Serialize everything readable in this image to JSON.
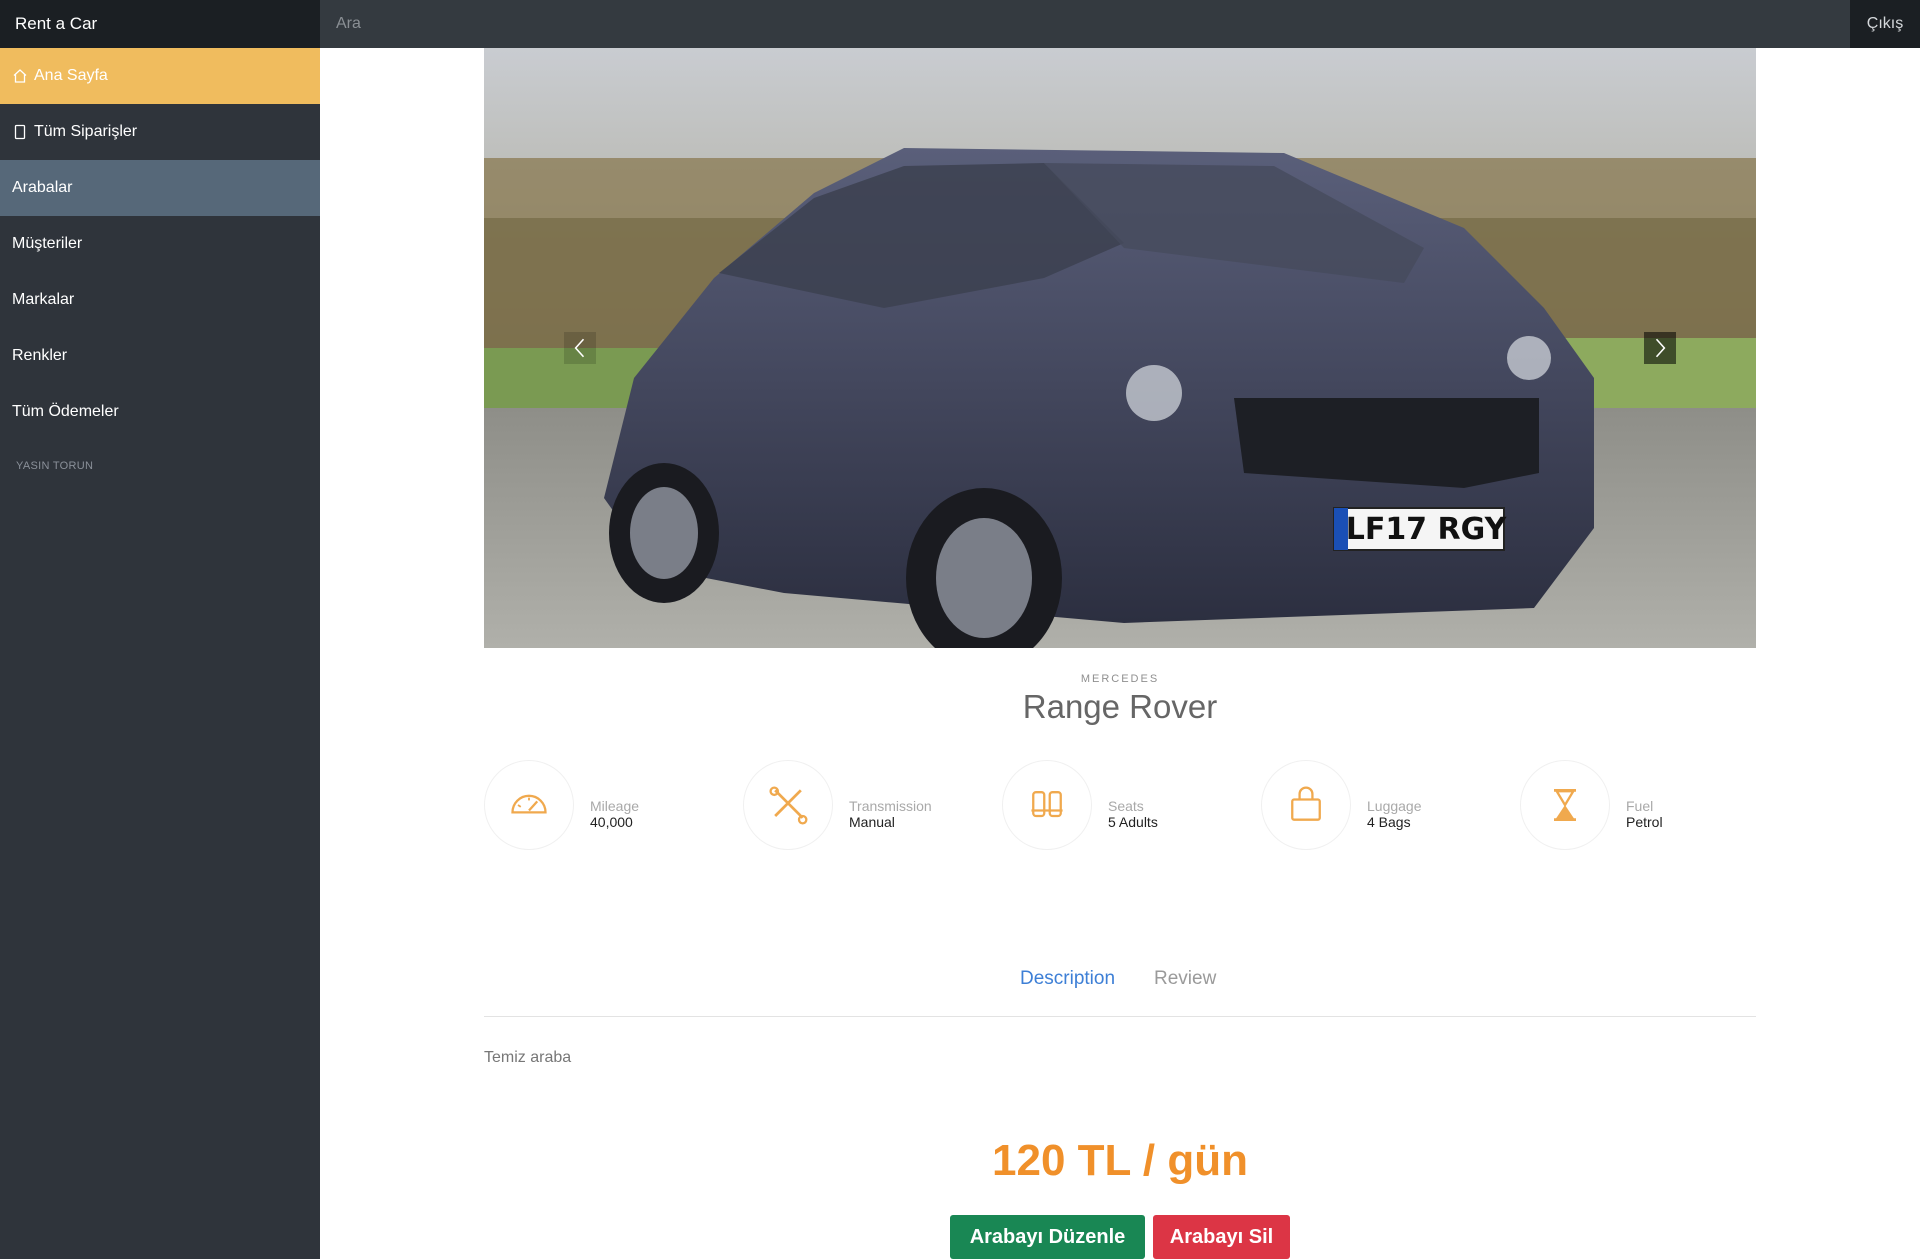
{
  "header": {
    "brand": "Rent a Car",
    "search_placeholder": "Ara",
    "logout_label": "Çıkış"
  },
  "sidebar": {
    "items": [
      {
        "label": "Ana Sayfa",
        "icon": "home-icon",
        "state": "active"
      },
      {
        "label": "Tüm Siparişler",
        "icon": "phone-icon",
        "state": "normal"
      },
      {
        "label": "Arabalar",
        "icon": "",
        "state": "selected"
      },
      {
        "label": "Müşteriler",
        "icon": "",
        "state": "normal"
      },
      {
        "label": "Markalar",
        "icon": "",
        "state": "normal"
      },
      {
        "label": "Renkler",
        "icon": "",
        "state": "normal"
      },
      {
        "label": "Tüm Ödemeler",
        "icon": "",
        "state": "normal"
      }
    ],
    "footer": "YASIN TORUN"
  },
  "car": {
    "brand": "MERCEDES",
    "model": "Range Rover",
    "plate": "LF17 RGY",
    "features": [
      {
        "label": "Mileage",
        "value": "40,000",
        "icon": "speedometer-icon"
      },
      {
        "label": "Transmission",
        "value": "Manual",
        "icon": "wrench-screwdriver-icon"
      },
      {
        "label": "Seats",
        "value": "5 Adults",
        "icon": "car-seat-icon"
      },
      {
        "label": "Luggage",
        "value": "4 Bags",
        "icon": "bag-icon"
      },
      {
        "label": "Fuel",
        "value": "Petrol",
        "icon": "hourglass-icon"
      }
    ],
    "tabs": {
      "description": "Description",
      "review": "Review"
    },
    "description": "Temiz araba",
    "price": "120 TL / gün"
  },
  "actions": {
    "edit_label": "Arabayı Düzenle",
    "delete_label": "Arabayı Sil"
  },
  "colors": {
    "accent": "#f0bc5e",
    "price": "#f0902a",
    "edit": "#198754",
    "delete": "#dc3545",
    "tab_active": "#3d7fd6"
  }
}
